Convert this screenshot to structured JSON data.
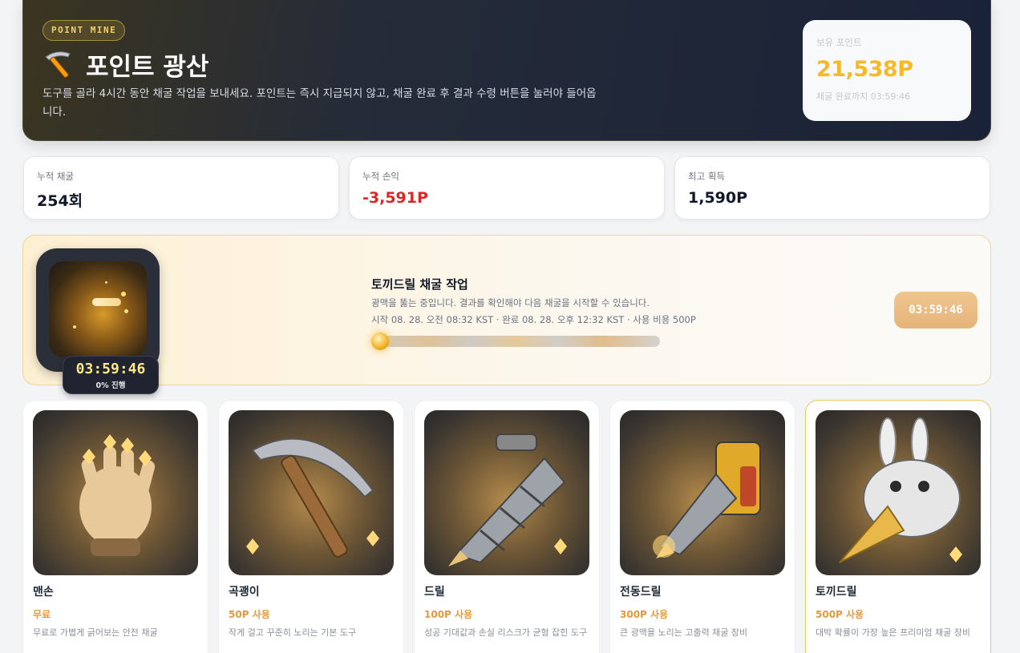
{
  "hero": {
    "badge": "POINT MINE",
    "title": "포인트 광산",
    "description": "도구를 골라 4시간 동안 채굴 작업을 보내세요. 포인트는 즉시 지급되지 않고, 채굴 완료 후 결과 수령 버튼을 눌러야 들어옵니다.",
    "balance_label": "보유 포인트",
    "balance_value": "21,538P",
    "balance_sub": "채굴 완료까지 03:59:46"
  },
  "stats": [
    {
      "label": "누적 채굴",
      "value": "254회"
    },
    {
      "label": "누적 손익",
      "value": "-3,591P"
    },
    {
      "label": "최고 획득",
      "value": "1,590P"
    }
  ],
  "job": {
    "timer": "03:59:46",
    "progress_text": "0% 진행",
    "progress_percent": 0,
    "title": "토끼드릴 채굴 작업",
    "description": "광맥을 뚫는 중입니다. 결과를 확인해야 다음 채굴을 시작할 수 있습니다.",
    "meta": "시작 08. 28. 오전 08:32 KST · 완료 08. 28. 오후 12:32 KST · 사용 비용 500P",
    "button_timer": "03:59:46"
  },
  "tools": [
    {
      "name": "맨손",
      "cost": "무료",
      "description": "무료로 가볍게 긁어보는 안전 채굴",
      "icon": "glove-icon"
    },
    {
      "name": "곡괭이",
      "cost": "50P 사용",
      "description": "작게 걸고 꾸준히 노리는 기본 도구",
      "icon": "pickaxe-icon"
    },
    {
      "name": "드릴",
      "cost": "100P 사용",
      "description": "성공 기대값과 손실 리스크가 균형 잡힌 도구",
      "icon": "drill-icon"
    },
    {
      "name": "전동드릴",
      "cost": "300P 사용",
      "description": "큰 광맥을 노리는 고출력 채굴 장비",
      "icon": "power-drill-icon"
    },
    {
      "name": "토끼드릴",
      "cost": "500P 사용",
      "description": "대박 확률이 가장 높은 프리미엄 채굴 장비",
      "icon": "rabbit-drill-icon"
    }
  ],
  "colors": {
    "accent_gold": "#f5b92a",
    "negative": "#dc2626",
    "cost": "#e39a3a"
  }
}
